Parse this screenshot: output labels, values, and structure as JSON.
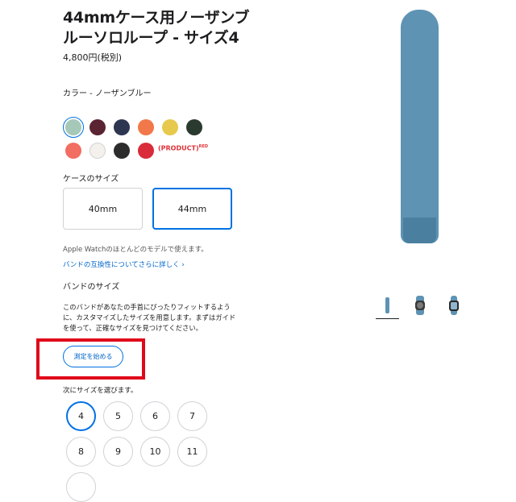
{
  "product": {
    "title_line1": "44mmケース用ノーザンブ",
    "title_line2": "ルーソロループ - サイズ4",
    "price": "4,800円(税別)"
  },
  "color": {
    "label": "カラー - ノーザンブルー",
    "swatches": [
      {
        "name": "northern-blue",
        "hex": "#a6c8b8",
        "selected": true
      },
      {
        "name": "burgundy",
        "hex": "#5a2432"
      },
      {
        "name": "navy",
        "hex": "#2c3650"
      },
      {
        "name": "orange",
        "hex": "#f27849"
      },
      {
        "name": "yellow",
        "hex": "#e7c94d"
      },
      {
        "name": "dark-green",
        "hex": "#2b3a2f"
      },
      {
        "name": "coral",
        "hex": "#f26d62"
      },
      {
        "name": "white",
        "hex": "#f4f1ec"
      },
      {
        "name": "black",
        "hex": "#2c2c2c"
      },
      {
        "name": "red",
        "hex": "#d92b3a"
      }
    ],
    "product_red_label": "(PRODUCT)",
    "product_red_sup": "RED"
  },
  "case_size": {
    "label": "ケースのサイズ",
    "options": [
      "40mm",
      "44mm"
    ],
    "selected": "44mm",
    "note": "Apple Watchのほとんどのモデルで使えます。",
    "link": "バンドの互換性についてさらに詳しく ›"
  },
  "band_size": {
    "label": "バンドのサイズ",
    "desc": "このバンドがあなたの手首にぴったりフィットするように、カスタマイズしたサイズを用意します。まずはガイドを使って、正確なサイズを見つけてください。",
    "measure_button": "測定を始める",
    "choose_label": "次にサイズを選びます。",
    "sizes": [
      "4",
      "5",
      "6",
      "7",
      "8",
      "9",
      "10",
      "11"
    ],
    "selected": "4"
  },
  "accent": "#0071e3",
  "highlight_color": "#e0081a"
}
